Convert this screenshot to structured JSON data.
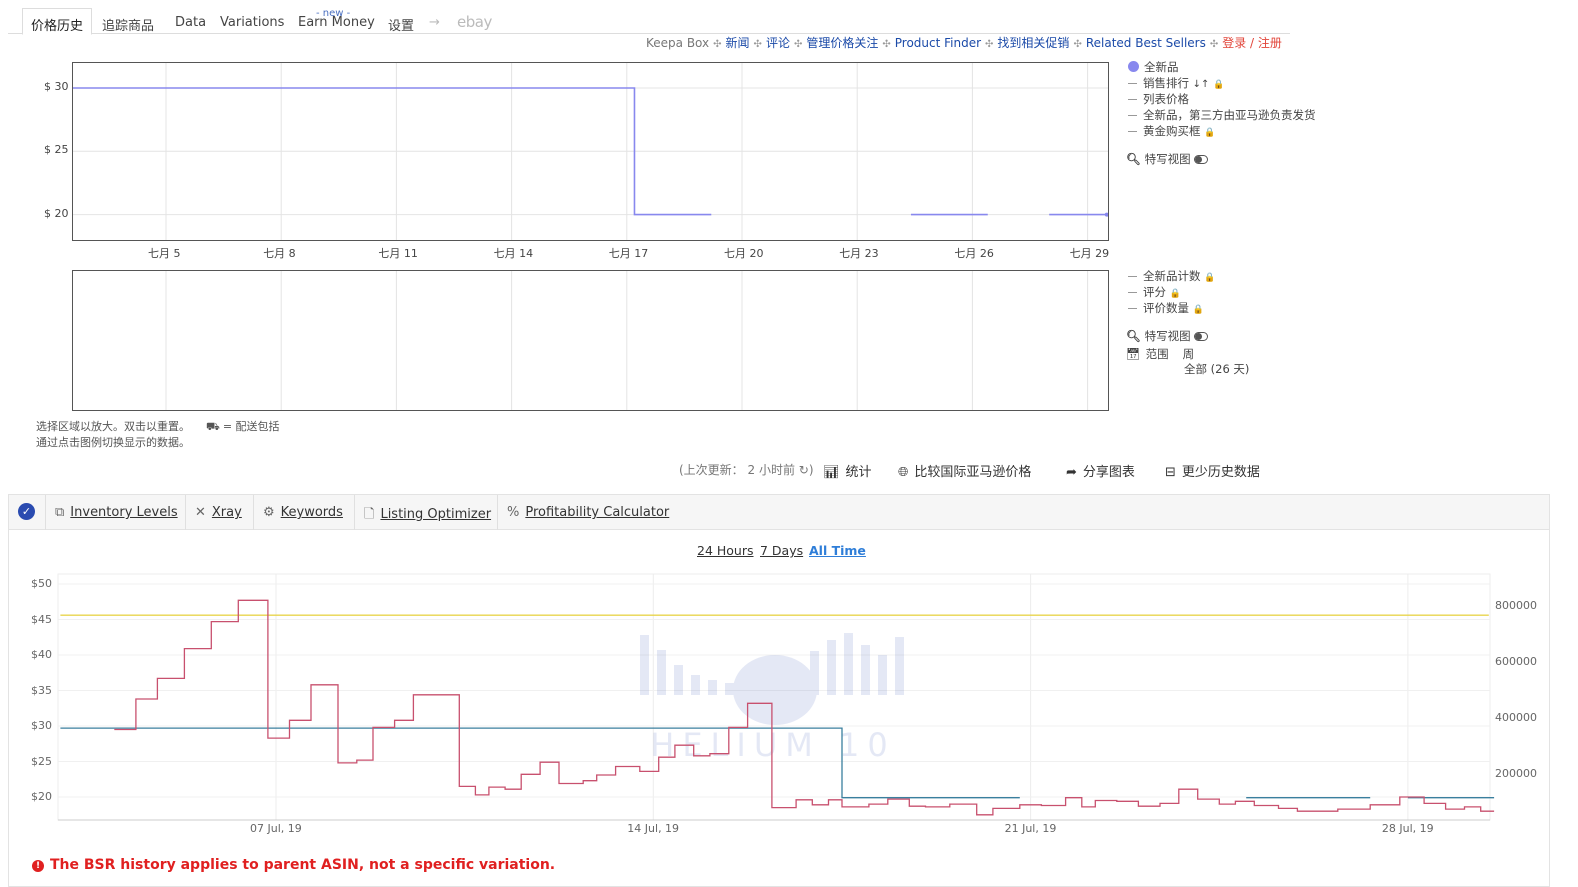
{
  "nav": {
    "tabs": [
      "价格历史",
      "追踪商品",
      "Data",
      "Variations",
      "Earn Money",
      "设置"
    ],
    "new_tag": "- new -",
    "arrow": "→",
    "ebay": "ebay"
  },
  "links": [
    "Keepa Box",
    "新闻",
    "评论",
    "管理价格关注",
    "Product Finder",
    "找到相关促销",
    "Related Best Sellers",
    "登录 / 注册"
  ],
  "keepa_chart": {
    "type": "line",
    "y_ticks": [
      "$ 30",
      "$ 25",
      "$ 20"
    ],
    "x_ticks": [
      "七月 5",
      "七月 8",
      "七月 11",
      "七月 14",
      "七月 17",
      "七月 20",
      "七月 23",
      "七月 26",
      "七月 29"
    ],
    "ylim": [
      18.5,
      32
    ],
    "series_color": "#8888ee",
    "new_price_segments": [
      [
        [
          2.0,
          30
        ],
        [
          17.2,
          30
        ],
        [
          17.2,
          20
        ],
        [
          19.2,
          20
        ]
      ],
      [
        [
          24.4,
          20
        ],
        [
          26.4,
          20
        ]
      ],
      [
        [
          28.0,
          20
        ],
        [
          29.5,
          20
        ]
      ]
    ]
  },
  "keepa_legend": {
    "items": [
      "全新品",
      "销售排行",
      "列表价格",
      "全新品，第三方由亚马逊负责发货",
      "黄金购买框"
    ],
    "closeup": "特写视图"
  },
  "keepa_legend2": {
    "items": [
      "全新品计数",
      "评分",
      "评价数量"
    ],
    "closeup": "特写视图",
    "range_label": "范围",
    "range_week": "周",
    "range_all": "全部 (26 天)"
  },
  "notes": {
    "line1": "选择区域以放大。双击以重置。",
    "shipping": "= 配送包括",
    "line2": "通过点击图例切换显示的数据。"
  },
  "actions": {
    "last_update": "(上次更新： 2 小时前",
    "stats": "统计",
    "compare": "比较国际亚马逊价格",
    "share": "分享图表",
    "less_history": "更少历史数据"
  },
  "h10": {
    "tabs": [
      "Inventory Levels",
      "Xray",
      "Keywords",
      "Listing Optimizer",
      "Profitability Calculator"
    ],
    "ranges": [
      "24 Hours",
      "7 Days",
      "All Time"
    ],
    "watermark": "HELIUM 10",
    "warning": "The BSR history applies to parent ASIN, not a specific variation."
  },
  "chart_data": {
    "type": "line",
    "x_ticks": [
      "07 Jul, 19",
      "14 Jul, 19",
      "21 Jul, 19",
      "28 Jul, 19"
    ],
    "y_left_ticks": [
      "$50",
      "$45",
      "$40",
      "$35",
      "$30",
      "$25",
      "$20"
    ],
    "y_right_ticks": [
      "800000",
      "600000",
      "400000",
      "200000"
    ],
    "ylim_left": [
      17,
      51
    ],
    "ylim_right": [
      0,
      900000
    ],
    "series": [
      {
        "color": "#e8d44d",
        "axis": "left",
        "points": [
          [
            3.0,
            45.6
          ],
          [
            29.5,
            45.6
          ]
        ]
      },
      {
        "color": "#3a7f9e",
        "axis": "left",
        "points": [
          [
            3.0,
            29.7
          ],
          [
            17.5,
            29.7
          ],
          [
            17.5,
            19.9
          ],
          [
            20.8,
            19.9
          ]
        ]
      },
      {
        "color": "#3a7f9e",
        "axis": "left",
        "points": [
          [
            25.0,
            19.9
          ],
          [
            27.3,
            19.9
          ]
        ]
      },
      {
        "color": "#3a7f9e",
        "axis": "left",
        "points": [
          [
            28.0,
            19.9
          ],
          [
            29.6,
            19.9
          ]
        ]
      },
      {
        "color": "#c8506e",
        "axis": "left",
        "points": [
          [
            4.0,
            29.5
          ],
          [
            4.4,
            29.5
          ],
          [
            4.4,
            33.8
          ],
          [
            4.8,
            33.8
          ],
          [
            4.8,
            36.7
          ],
          [
            5.3,
            36.7
          ],
          [
            5.3,
            40.9
          ],
          [
            5.8,
            40.9
          ],
          [
            5.8,
            44.7
          ],
          [
            6.3,
            44.7
          ],
          [
            6.3,
            47.7
          ],
          [
            6.85,
            47.7
          ],
          [
            6.85,
            28.3
          ],
          [
            7.25,
            28.3
          ],
          [
            7.25,
            30.8
          ],
          [
            7.65,
            30.8
          ],
          [
            7.65,
            35.8
          ],
          [
            8.15,
            35.8
          ],
          [
            8.15,
            24.8
          ],
          [
            8.5,
            24.8
          ],
          [
            8.5,
            25.2
          ],
          [
            8.8,
            25.2
          ],
          [
            8.8,
            29.8
          ],
          [
            9.2,
            29.8
          ],
          [
            9.2,
            30.8
          ],
          [
            9.55,
            30.8
          ],
          [
            9.55,
            34.4
          ],
          [
            10.4,
            34.4
          ],
          [
            10.4,
            21.5
          ],
          [
            10.7,
            21.5
          ],
          [
            10.7,
            20.3
          ],
          [
            10.95,
            20.3
          ],
          [
            10.95,
            21.4
          ],
          [
            11.25,
            21.4
          ],
          [
            11.25,
            21.1
          ],
          [
            11.55,
            21.1
          ],
          [
            11.55,
            23.2
          ],
          [
            11.9,
            23.2
          ],
          [
            11.9,
            24.9
          ],
          [
            12.25,
            24.9
          ],
          [
            12.25,
            21.9
          ],
          [
            12.7,
            21.9
          ],
          [
            12.7,
            22.3
          ],
          [
            12.95,
            22.3
          ],
          [
            12.95,
            23.1
          ],
          [
            13.3,
            23.1
          ],
          [
            13.3,
            24.3
          ],
          [
            13.75,
            24.3
          ],
          [
            13.75,
            23.6
          ],
          [
            14.1,
            23.6
          ],
          [
            14.1,
            25.6
          ],
          [
            14.4,
            25.6
          ],
          [
            14.4,
            27.3
          ],
          [
            14.75,
            27.3
          ],
          [
            14.75,
            25.8
          ],
          [
            15.05,
            25.8
          ],
          [
            15.05,
            26.1
          ],
          [
            15.4,
            26.1
          ],
          [
            15.4,
            29.8
          ],
          [
            15.75,
            29.8
          ],
          [
            15.75,
            33.2
          ],
          [
            16.2,
            33.2
          ],
          [
            16.2,
            18.5
          ],
          [
            16.65,
            18.5
          ],
          [
            16.65,
            19.6
          ],
          [
            16.95,
            19.6
          ],
          [
            16.95,
            18.9
          ],
          [
            17.25,
            18.9
          ],
          [
            17.25,
            19.6
          ],
          [
            17.5,
            19.6
          ],
          [
            17.5,
            18.6
          ],
          [
            18.0,
            18.6
          ],
          [
            18.0,
            19.0
          ],
          [
            18.35,
            19.0
          ],
          [
            18.35,
            19.7
          ],
          [
            18.75,
            19.7
          ],
          [
            18.75,
            18.7
          ],
          [
            19.05,
            18.7
          ],
          [
            19.05,
            18.6
          ],
          [
            19.5,
            18.6
          ],
          [
            19.5,
            19.0
          ],
          [
            20.0,
            19.0
          ],
          [
            20.0,
            17.5
          ],
          [
            20.3,
            17.5
          ],
          [
            20.3,
            18.4
          ],
          [
            20.8,
            18.4
          ],
          [
            20.8,
            18.9
          ],
          [
            21.2,
            18.9
          ],
          [
            21.2,
            18.8
          ],
          [
            21.65,
            18.8
          ],
          [
            21.65,
            19.9
          ],
          [
            21.95,
            19.9
          ],
          [
            21.95,
            18.6
          ],
          [
            22.2,
            18.6
          ],
          [
            22.2,
            19.5
          ],
          [
            22.6,
            19.5
          ],
          [
            22.6,
            19.4
          ],
          [
            23.0,
            19.4
          ],
          [
            23.0,
            18.7
          ],
          [
            23.4,
            18.7
          ],
          [
            23.4,
            19.1
          ],
          [
            23.75,
            19.1
          ],
          [
            23.75,
            21.1
          ],
          [
            24.1,
            21.1
          ],
          [
            24.1,
            19.7
          ],
          [
            24.5,
            19.7
          ],
          [
            24.5,
            19.0
          ],
          [
            24.8,
            19.0
          ],
          [
            24.8,
            19.4
          ],
          [
            25.15,
            19.4
          ],
          [
            25.15,
            18.8
          ],
          [
            25.6,
            18.8
          ],
          [
            25.6,
            18.4
          ],
          [
            25.95,
            18.4
          ],
          [
            25.95,
            18.0
          ],
          [
            26.7,
            18.0
          ],
          [
            26.7,
            18.3
          ],
          [
            27.3,
            18.3
          ],
          [
            27.3,
            18.9
          ],
          [
            27.85,
            18.9
          ],
          [
            27.85,
            20.0
          ],
          [
            28.3,
            20.0
          ],
          [
            28.3,
            19.1
          ],
          [
            28.7,
            19.1
          ],
          [
            28.7,
            18.3
          ],
          [
            29.05,
            18.3
          ],
          [
            29.05,
            18.6
          ],
          [
            29.35,
            18.6
          ],
          [
            29.35,
            18.0
          ],
          [
            29.6,
            18.0
          ]
        ]
      }
    ]
  }
}
